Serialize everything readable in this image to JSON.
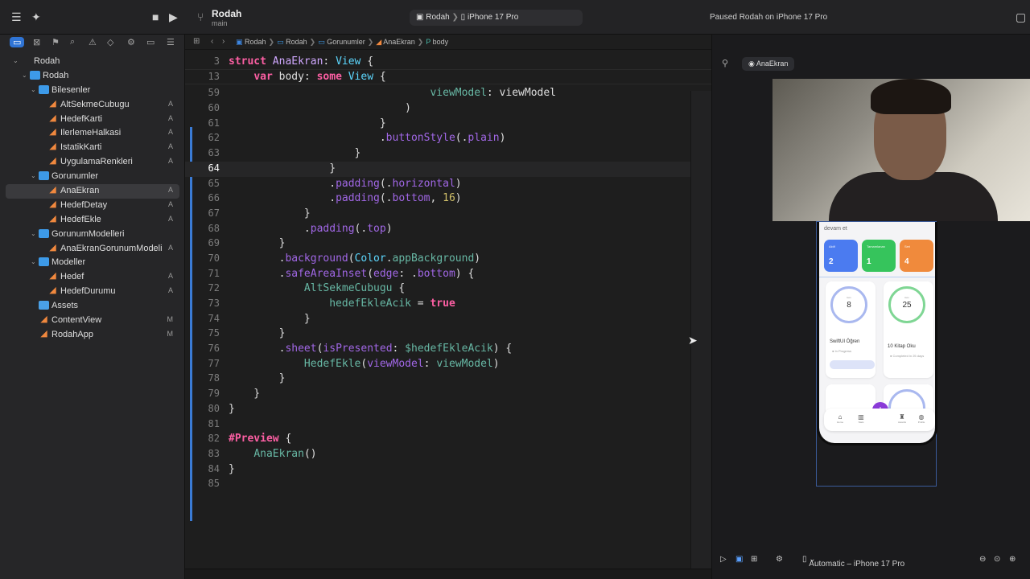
{
  "titlebar": {
    "project": "Rodah",
    "branch": "main",
    "scheme_app": "Rodah",
    "scheme_device": "iPhone 17 Pro",
    "status": "Paused Rodah on iPhone 17 Pro",
    "icons": [
      "sidebar-icon",
      "sparkle-icon",
      "stop-icon",
      "run-icon",
      "branch-icon",
      "inspector-icon"
    ]
  },
  "navigator": {
    "toolbar_icons": [
      "folder-icon",
      "source-control-icon",
      "bookmark-icon",
      "find-icon",
      "issue-icon",
      "test-icon",
      "debug-icon",
      "breakpoint-icon",
      "report-icon"
    ],
    "items": [
      {
        "label": "Rodah",
        "kind": "project",
        "badge": ""
      },
      {
        "label": "Rodah",
        "kind": "folder",
        "badge": ""
      },
      {
        "label": "Bilesenler",
        "kind": "folder",
        "badge": ""
      },
      {
        "label": "AltSekmeCubugu",
        "kind": "swift",
        "badge": "A"
      },
      {
        "label": "HedefKarti",
        "kind": "swift",
        "badge": "A"
      },
      {
        "label": "IlerlemeHalkasi",
        "kind": "swift",
        "badge": "A"
      },
      {
        "label": "IstatikKarti",
        "kind": "swift",
        "badge": "A"
      },
      {
        "label": "UygulamaRenkleri",
        "kind": "swift",
        "badge": "A"
      },
      {
        "label": "Gorunumler",
        "kind": "folder",
        "badge": ""
      },
      {
        "label": "AnaEkran",
        "kind": "swift",
        "badge": "A"
      },
      {
        "label": "HedefDetay",
        "kind": "swift",
        "badge": "A"
      },
      {
        "label": "HedefEkle",
        "kind": "swift",
        "badge": "A"
      },
      {
        "label": "GorunumModelleri",
        "kind": "folder",
        "badge": ""
      },
      {
        "label": "AnaEkranGorunumModeli",
        "kind": "swift",
        "badge": "A"
      },
      {
        "label": "Modeller",
        "kind": "folder",
        "badge": ""
      },
      {
        "label": "Hedef",
        "kind": "swift",
        "badge": "A"
      },
      {
        "label": "HedefDurumu",
        "kind": "swift",
        "badge": "A"
      },
      {
        "label": "Assets",
        "kind": "assets",
        "badge": ""
      },
      {
        "label": "ContentView",
        "kind": "swift",
        "badge": "M"
      },
      {
        "label": "RodahApp",
        "kind": "swift",
        "badge": "M"
      }
    ]
  },
  "jumpbar": {
    "crumbs": [
      "Rodah",
      "Rodah",
      "Gorunumler",
      "AnaEkran",
      "body"
    ]
  },
  "code": {
    "sticky": [
      {
        "no": "3",
        "html": "<span class=\"kw\">struct</span> <span class=\"ty\">AnaEkran</span>: <span class=\"tyb\">View</span> {"
      },
      {
        "no": "13",
        "html": "    <span class=\"kw\">var</span> body: <span class=\"kw\">some</span> <span class=\"tyb\">View</span> {"
      }
    ],
    "lines": [
      {
        "no": "59",
        "html": "                                <span class=\"prop\">viewModel</span>: viewModel"
      },
      {
        "no": "60",
        "html": "                            )"
      },
      {
        "no": "61",
        "html": "                        }"
      },
      {
        "no": "62",
        "html": "                        .<span class=\"mth\">buttonStyle</span>(.<span class=\"mth\">plain</span>)"
      },
      {
        "no": "63",
        "html": "                    }"
      },
      {
        "no": "64",
        "html": "                }"
      },
      {
        "no": "65",
        "html": "                .<span class=\"mth\">padding</span>(.<span class=\"mth\">horizontal</span>)"
      },
      {
        "no": "66",
        "html": "                .<span class=\"mth\">padding</span>(.<span class=\"mth\">bottom</span>, <span class=\"num\">16</span>)"
      },
      {
        "no": "67",
        "html": "            }"
      },
      {
        "no": "68",
        "html": "            .<span class=\"mth\">padding</span>(.<span class=\"mth\">top</span>)"
      },
      {
        "no": "69",
        "html": "        }"
      },
      {
        "no": "70",
        "html": "        .<span class=\"mth\">background</span>(<span class=\"tyb\">Color</span>.<span class=\"fn\">appBackground</span>)"
      },
      {
        "no": "71",
        "html": "        .<span class=\"mth\">safeAreaInset</span>(<span class=\"mth\">edge</span>: .<span class=\"mth\">bottom</span>) {"
      },
      {
        "no": "72",
        "html": "            <span class=\"fn\">AltSekmeCubugu</span> {"
      },
      {
        "no": "73",
        "html": "                <span class=\"fn\">hedefEkleAcik</span> = <span class=\"kw\">true</span>"
      },
      {
        "no": "74",
        "html": "            }"
      },
      {
        "no": "75",
        "html": "        }"
      },
      {
        "no": "76",
        "html": "        .<span class=\"mth\">sheet</span>(<span class=\"mth\">isPresented</span>: <span class=\"fn\">$hedefEkleAcik</span>) {"
      },
      {
        "no": "77",
        "html": "            <span class=\"fn\">HedefEkle</span>(<span class=\"mth\">viewModel</span>: <span class=\"fn\">viewModel</span>)"
      },
      {
        "no": "78",
        "html": "        }"
      },
      {
        "no": "79",
        "html": "    }"
      },
      {
        "no": "80",
        "html": "}"
      },
      {
        "no": "81",
        "html": ""
      },
      {
        "no": "82",
        "html": "<span class=\"kw\">#Preview</span> {"
      },
      {
        "no": "83",
        "html": "    <span class=\"fn\">AnaEkran</span>()"
      },
      {
        "no": "84",
        "html": "}"
      },
      {
        "no": "85",
        "html": ""
      }
    ],
    "current_line": "64"
  },
  "canvas": {
    "preview_label": "AnaEkran",
    "device_label": "Automatic – iPhone 17 Pro",
    "phone": {
      "subtitle": "devam et",
      "stats": [
        {
          "label": "Aktif",
          "value": "2",
          "color": "#4b7bf0"
        },
        {
          "label": "Tamamlanan",
          "value": "1",
          "color": "#36c45c"
        },
        {
          "label": "Seri",
          "value": "4",
          "color": "#f08a3c"
        }
      ],
      "cards": [
        {
          "ring_value": "8",
          "ring_label": "Gün",
          "title": "SwiftUI Öğren",
          "status": "In Progress",
          "ring_color": "#a9b8ef"
        },
        {
          "ring_value": "25",
          "ring_label": "Gün",
          "title": "10 Kitap Oku",
          "status": "Completed in 25 days",
          "ring_color": "#7fd694"
        }
      ],
      "tabs": [
        "Home",
        "Stats",
        "Awards",
        "Profile"
      ],
      "fab": "+"
    }
  }
}
